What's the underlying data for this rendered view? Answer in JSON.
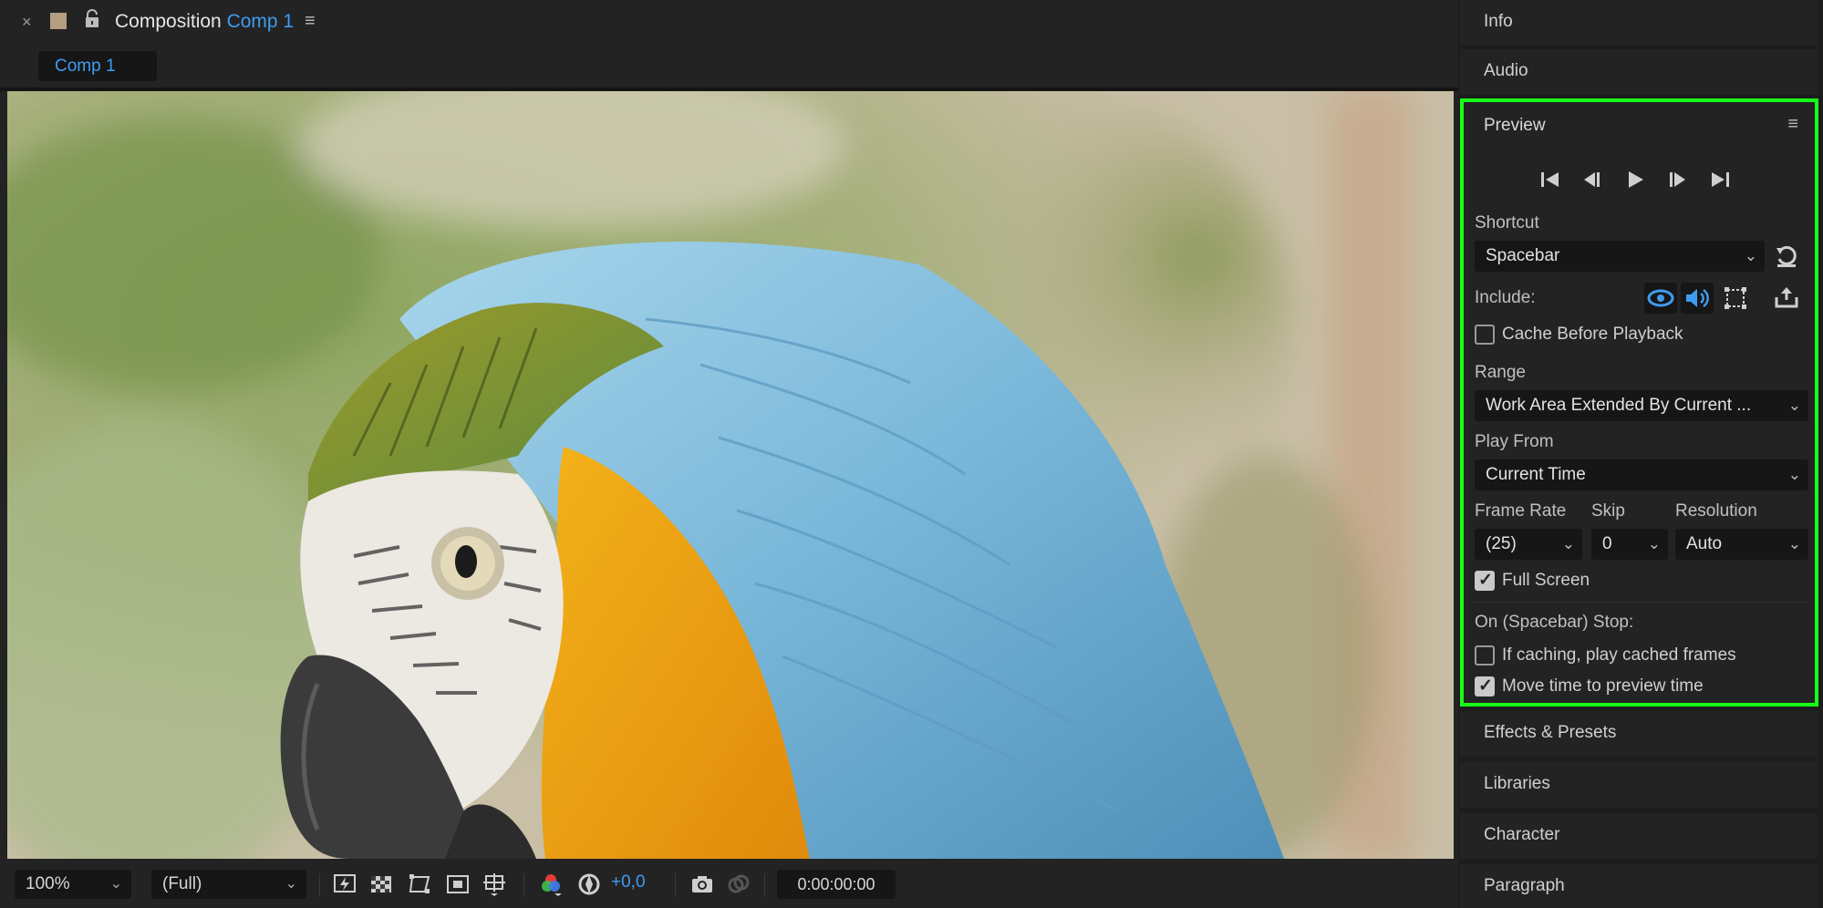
{
  "composition": {
    "close_glyph": "×",
    "title_prefix": "Composition",
    "title_name": "Comp 1",
    "menu_glyph": "≡",
    "tab_label": "Comp 1",
    "icons": [
      "close-icon",
      "color-swatch",
      "lock-icon",
      "panel-menu-icon"
    ]
  },
  "viewer_toolbar": {
    "zoom": "100%",
    "resolution": "(Full)",
    "exposure": "+0,0",
    "timecode": "0:00:00:00",
    "chevron": "⌄"
  },
  "right_panels": {
    "info": "Info",
    "audio": "Audio",
    "effects": "Effects & Presets",
    "libraries": "Libraries",
    "character": "Character",
    "paragraph": "Paragraph"
  },
  "preview": {
    "title": "Preview",
    "menu_glyph": "≡",
    "shortcut_label": "Shortcut",
    "shortcut_value": "Spacebar",
    "include_label": "Include:",
    "cache_label": "Cache Before Playback",
    "cache_checked": false,
    "range_label": "Range",
    "range_value": "Work Area Extended By Current ...",
    "play_from_label": "Play From",
    "play_from_value": "Current Time",
    "frame_rate_label": "Frame Rate",
    "frame_rate_value": "(25)",
    "skip_label": "Skip",
    "skip_value": "0",
    "resolution_label": "Resolution",
    "resolution_value": "Auto",
    "full_screen_label": "Full Screen",
    "full_screen_checked": true,
    "stop_label": "On (Spacebar) Stop:",
    "if_caching_label": "If caching, play cached frames",
    "if_caching_checked": false,
    "move_time_label": "Move time to preview time",
    "move_time_checked": true,
    "chevron": "⌄"
  },
  "colors": {
    "accent": "#3f9cf0",
    "highlight": "#18ff18",
    "panel": "#232323",
    "field": "#161616"
  }
}
